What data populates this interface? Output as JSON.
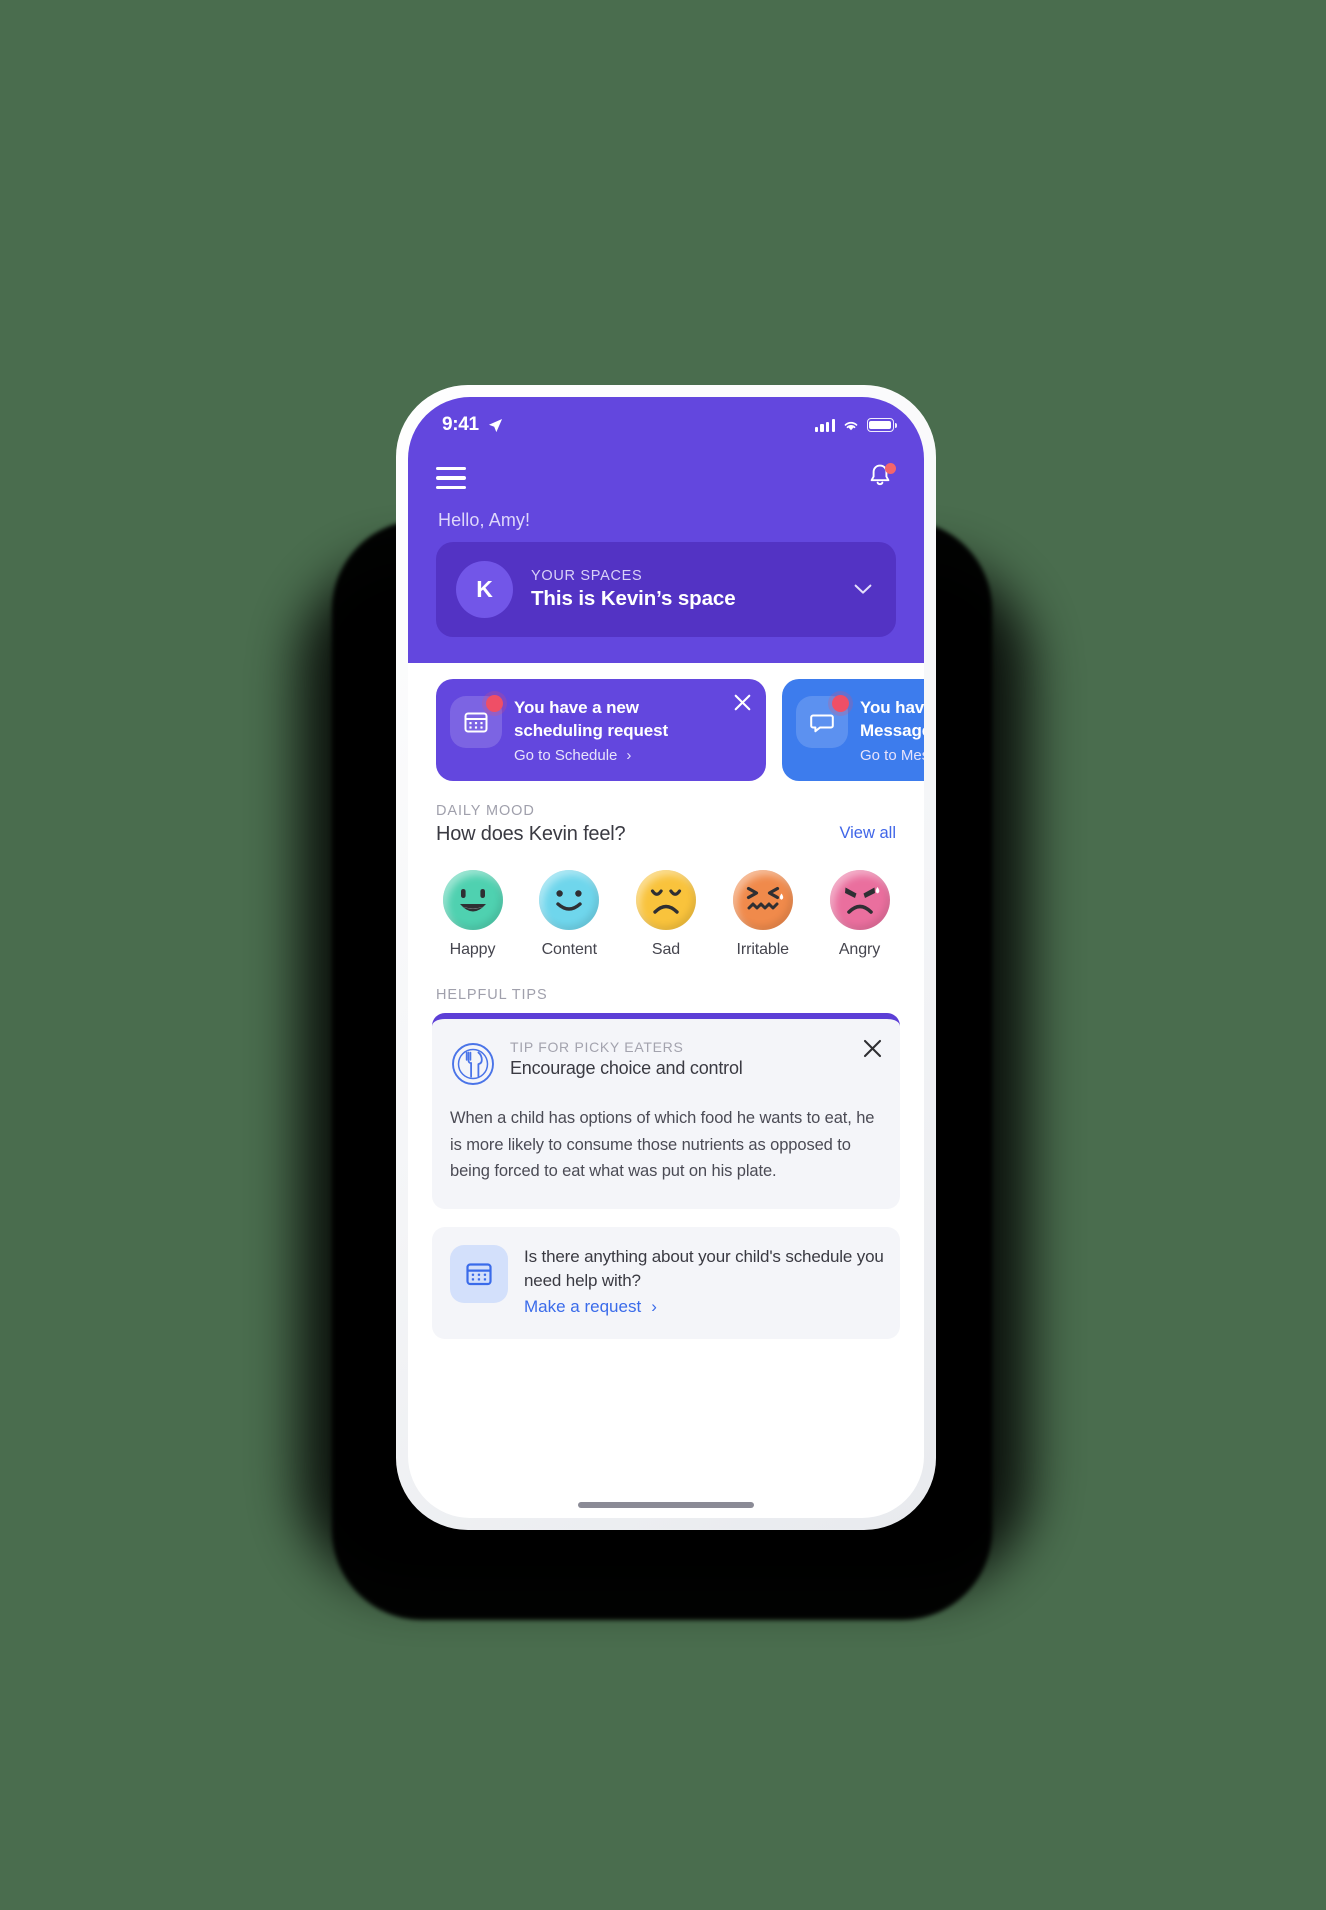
{
  "theme": {
    "background": "#4a6d4e",
    "primary_purple": "#6347de",
    "deep_purple": "#5333c4",
    "accent_blue": "#3d7ced",
    "link_blue": "#4066e8",
    "alert_red": "#ef4f66"
  },
  "status_bar": {
    "time": "9:41",
    "location_icon": "location-arrow-icon",
    "signal_icon": "cellular-signal-icon",
    "wifi_icon": "wifi-icon",
    "battery_icon": "battery-icon"
  },
  "header": {
    "menu_icon": "hamburger-menu-icon",
    "bell_icon": "notification-bell-icon",
    "greeting": "Hello, Amy!",
    "space_card": {
      "avatar_initial": "K",
      "label": "YOUR SPACES",
      "name": "This is Kevin’s space",
      "chevron_icon": "chevron-down-icon"
    }
  },
  "notifications": [
    {
      "icon": "calendar-icon",
      "title": "You have a new\nscheduling request",
      "link": "Go to Schedule",
      "arrow": "›",
      "close_icon": "close-icon",
      "color": "purple"
    },
    {
      "icon": "message-bubble-icon",
      "title": "You have a new\nMessage",
      "link": "Go to Messages",
      "arrow": "›",
      "close_icon": "close-icon",
      "color": "blue"
    }
  ],
  "daily_mood": {
    "kicker": "DAILY MOOD",
    "title": "How does Kevin feel?",
    "view_all": "View all",
    "moods": [
      {
        "label": "Happy",
        "color": "#4fd1b0",
        "icon": "happy-face-icon"
      },
      {
        "label": "Content",
        "color": "#6fd6ec",
        "icon": "content-face-icon"
      },
      {
        "label": "Sad",
        "color": "#f9c33c",
        "icon": "sad-face-icon"
      },
      {
        "label": "Irritable",
        "color": "#f08a4b",
        "icon": "irritable-face-icon"
      },
      {
        "label": "Angry",
        "color": "#ea6f9e",
        "icon": "angry-face-icon"
      }
    ]
  },
  "helpful_tips": {
    "kicker": "HELPFUL TIPS",
    "card": {
      "icon": "plate-fork-knife-icon",
      "kicker": "TIP FOR PICKY EATERS",
      "title": "Encourage choice and control",
      "body": "When a child has options of which food he wants to eat, he is more likely to consume those nutrients as opposed to being forced to eat what was put on his plate.",
      "close_icon": "close-icon"
    }
  },
  "request_card": {
    "icon": "calendar-icon",
    "text": "Is there anything about your child's schedule you need help with?",
    "link": "Make a request",
    "arrow": "›"
  }
}
